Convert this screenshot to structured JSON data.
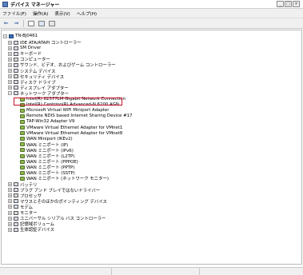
{
  "window": {
    "title": "デバイス マネージャー",
    "controls": [
      "_",
      "□",
      "×"
    ]
  },
  "menu": [
    "ファイル(F)",
    "操作(A)",
    "表示(V)",
    "ヘルプ(H)"
  ],
  "toolbar": {
    "icons": [
      "back-arrow-icon",
      "forward-arrow-icon",
      "properties-icon",
      "help-icon",
      "scan-hardware-icon"
    ],
    "glyphs": [
      "⇐",
      "⇒"
    ]
  },
  "tree": {
    "root": "TN-BJ0461",
    "categories": [
      {
        "label": "IDE ATA/ATAPI コントローラー",
        "expanded": false
      },
      {
        "label": "SM Driver",
        "expanded": false
      },
      {
        "label": "キーボード",
        "expanded": false
      },
      {
        "label": "コンピューター",
        "expanded": false
      },
      {
        "label": "サウンド、ビデオ、およびゲーム コントローラー",
        "expanded": false
      },
      {
        "label": "システム デバイス",
        "expanded": false
      },
      {
        "label": "セキュリティ デバイス",
        "expanded": false
      },
      {
        "label": "ディスク ドライブ",
        "expanded": false
      },
      {
        "label": "ディスプレイ アダプター",
        "expanded": false
      },
      {
        "label": "ネットワーク アダプター",
        "expanded": true
      }
    ],
    "network_adapters": [
      "Intel(R) 82577LM Gigabit Network Connection",
      "Intel(R) Centrino(R) Advanced-N 6200 AGN",
      "Microsoft Virtual WiFi Miniport Adapter",
      "Remote NDIS based Internet Sharing Device #17",
      "TAP-Win32 Adapter V9",
      "VMware Virtual Ethernet Adapter for VMnet1",
      "VMware Virtual Ethernet Adapter for VMnet8",
      "WAN Miniport (IKEv2)",
      "WAN ミニポート (IP)",
      "WAN ミニポート (IPv6)",
      "WAN ミニポート (L2TP)",
      "WAN ミニポート (PPPOE)",
      "WAN ミニポート (PPTP)",
      "WAN ミニポート (SSTP)",
      "WAN ミニポート (ネットワーク モニター)"
    ],
    "categories_after": [
      "バッテリ",
      "プラグ アンド プレイではないドライバー",
      "プロセッサ",
      "マウスとそのほかのポインティング デバイス",
      "モデム",
      "モニター",
      "ユニバーサル シリアル バス コントローラー",
      "記憶域ボリューム",
      "生体認証デバイス"
    ],
    "selected_item": "Remote NDIS based Internet Sharing Device #17",
    "expander_collapsed": "+",
    "expander_expanded": "−"
  },
  "colors": {
    "highlight": "#c8102e",
    "accent": "#3b6fb6"
  }
}
